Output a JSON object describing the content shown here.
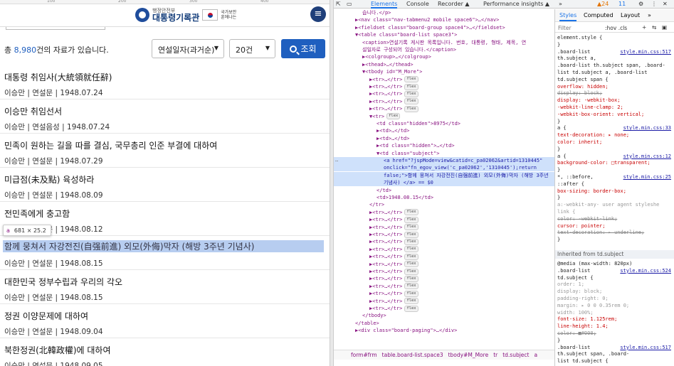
{
  "ruler": {
    "ticks": [
      "100",
      "200",
      "300",
      "400"
    ]
  },
  "site": {
    "logo_sub": "행정안전부",
    "logo_main": "대통령기록관",
    "logo_right": "국가보안 훈에나는",
    "menu_icon": "hamburger-icon"
  },
  "search": {
    "total_prefix": "총 ",
    "total_count": "8,980",
    "total_suffix": "건의 자료가 있습니다.",
    "order_value": "연설일자(과거순)",
    "count_value": "20건",
    "button_label": "조회"
  },
  "list": [
    {
      "title": "대통령 취임사(大統領就任辭)",
      "meta": "이승만 | 연설문 | 1948.07.24"
    },
    {
      "title": "이승만 취임선서",
      "meta": "이승만 | 연설음성 | 1948.07.24"
    },
    {
      "title": "민족이 원하는 길을 따를 결심, 국무총리 인준 부결에 대하여",
      "meta": "이승만 | 연설문 | 1948.07.29"
    },
    {
      "title": "미급점(未及點) 육성하라",
      "meta": "이승만 | 연설문 | 1948.08.09"
    },
    {
      "title": "전민족에게 충고함",
      "meta": "이승만 | 연설문 | 1948.08.12"
    },
    {
      "title": "함께 뭉쳐서 자강전진(自强前進) 외모(外侮)막자 (해방 3주년 기념사)",
      "meta": "이승만 | 연설문 | 1948.08.15"
    },
    {
      "title": "대한민국 정부수립과 우리의 각오",
      "meta": "이승만 | 연설문 | 1948.08.15"
    },
    {
      "title": "정권 이양문제에 대하여",
      "meta": "이승만 | 연설문 | 1948.09.04"
    },
    {
      "title": "북한정권(北韓政權)에 대하여",
      "meta": "이승만 | 연설문 | 1948.09.05"
    }
  ],
  "tooltip": {
    "tag": "a",
    "size": "681 × 25.2"
  },
  "devtools": {
    "tabs": [
      "Elements",
      "Console",
      "Recorder ▲",
      "Performance insights ▲",
      "»"
    ],
    "badges": [
      "▲24",
      "11"
    ],
    "dom_lines": [
      {
        "indent": 4,
        "html": "습니다.</p>"
      },
      {
        "indent": 2,
        "html": "▶<nav class=\"nav-tabmenu2 mobile space6\">…</nav>"
      },
      {
        "indent": 2,
        "html": "▶<fieldset class=\"board-group space4\">…</fieldset>"
      },
      {
        "indent": 2,
        "html": "▼<table class=\"board-list space3\">"
      },
      {
        "indent": 4,
        "html": "<caption>연설기록 게시판 목록입니다. 번호, 대통령, 형태, 제목, 연"
      },
      {
        "indent": 4,
        "html": "설일자로 구성되어 있습니다.</caption>"
      },
      {
        "indent": 4,
        "html": "▶<colgroup>…</colgroup>"
      },
      {
        "indent": 4,
        "html": "▶<thead>…</thead>"
      },
      {
        "indent": 4,
        "html": "▼<tbody id=\"M_More\">"
      },
      {
        "indent": 6,
        "html": "▶<tr>…</tr>",
        "flex": true
      },
      {
        "indent": 6,
        "html": "▶<tr>…</tr>",
        "flex": true
      },
      {
        "indent": 6,
        "html": "▶<tr>…</tr>",
        "flex": true
      },
      {
        "indent": 6,
        "html": "▶<tr>…</tr>",
        "flex": true
      },
      {
        "indent": 6,
        "html": "▶<tr>…</tr>",
        "flex": true
      },
      {
        "indent": 6,
        "html": "▼<tr>",
        "flex": true
      },
      {
        "indent": 8,
        "html": "<td class=\"hidden\">8975</td>"
      },
      {
        "indent": 8,
        "html": "▶<td>…</td>"
      },
      {
        "indent": 8,
        "html": "▶<td>…</td>"
      },
      {
        "indent": 8,
        "html": "▶<td class=\"hidden\">…</td>"
      },
      {
        "indent": 8,
        "html": "▼<td class=\"subject\">"
      },
      {
        "indent": 10,
        "html": "<a href=\"?jspMode=view&catid=c_pa02062&artid=1310445\"",
        "sel": true
      },
      {
        "indent": 10,
        "html": "onclick=\"fn_egov_view('c_pa02062','1310445');return",
        "sel": true
      },
      {
        "indent": 10,
        "html": "false;\">함께 뭉쳐서 자강전진(自强前進) 외모(外侮)막자 (해방 3주년",
        "sel": true
      },
      {
        "indent": 10,
        "html": "기념사) </a> == $0",
        "sel": true
      },
      {
        "indent": 8,
        "html": "</td>"
      },
      {
        "indent": 8,
        "html": "<td>1948.08.15</td>"
      },
      {
        "indent": 6,
        "html": "</tr>"
      },
      {
        "indent": 6,
        "html": "▶<tr>…</tr>",
        "flex": true
      },
      {
        "indent": 6,
        "html": "▶<tr>…</tr>",
        "flex": true
      },
      {
        "indent": 6,
        "html": "▶<tr>…</tr>",
        "flex": true
      },
      {
        "indent": 6,
        "html": "▶<tr>…</tr>",
        "flex": true
      },
      {
        "indent": 6,
        "html": "▶<tr>…</tr>",
        "flex": true
      },
      {
        "indent": 6,
        "html": "▶<tr>…</tr>",
        "flex": true
      },
      {
        "indent": 6,
        "html": "▶<tr>…</tr>",
        "flex": true
      },
      {
        "indent": 6,
        "html": "▶<tr>…</tr>",
        "flex": true
      },
      {
        "indent": 6,
        "html": "▶<tr>…</tr>",
        "flex": true
      },
      {
        "indent": 6,
        "html": "▶<tr>…</tr>",
        "flex": true
      },
      {
        "indent": 6,
        "html": "▶<tr>…</tr>",
        "flex": true
      },
      {
        "indent": 6,
        "html": "▶<tr>…</tr>",
        "flex": true
      },
      {
        "indent": 6,
        "html": "▶<tr>…</tr>",
        "flex": true
      },
      {
        "indent": 6,
        "html": "▶<tr>…</tr>",
        "flex": true
      },
      {
        "indent": 4,
        "html": "</tbody>"
      },
      {
        "indent": 2,
        "html": "</table>"
      },
      {
        "indent": 2,
        "html": "▶<div class=\"board-paging\">…</div>"
      }
    ],
    "breadcrumbs": [
      "form#frm",
      "table.board-list.space3",
      "tbody#M_More",
      "tr",
      "td.subject",
      "a"
    ],
    "styles_tabs": [
      "Styles",
      "Computed",
      "Layout",
      "»"
    ],
    "filter_placeholder": "Filter",
    "filter_buttons": ":hov .cls",
    "style_lines": [
      {
        "text": "element.style {",
        "cls": "sel-c"
      },
      {
        "text": "}",
        "cls": "sel-c"
      },
      {
        "text": ".board-list",
        "cls": "sel-c",
        "src": "style.min.css:517"
      },
      {
        "text": "th.subject a,",
        "cls": "sel-c"
      },
      {
        "text": ".board-list th.subject span, .board-",
        "cls": "sel-c"
      },
      {
        "text": "list td.subject a, .board-list",
        "cls": "sel-c"
      },
      {
        "text": "td.subject span {",
        "cls": "sel-c"
      },
      {
        "text": "  overflow: hidden;",
        "cls": "prop"
      },
      {
        "text": "  display: block;",
        "cls": "strike"
      },
      {
        "text": "  display: -webkit-box;",
        "cls": "prop"
      },
      {
        "text": "  -webkit-line-clamp: 2;",
        "cls": "prop"
      },
      {
        "text": "  -webkit-box-orient: vertical;",
        "cls": "prop"
      },
      {
        "text": "}",
        "cls": "sel-c"
      },
      {
        "text": "a {",
        "cls": "sel-c",
        "src": "style.min.css:33"
      },
      {
        "text": "  text-decoration: ▸ none;",
        "cls": "prop"
      },
      {
        "text": "  color: inherit;",
        "cls": "prop"
      },
      {
        "text": "}",
        "cls": "sel-c"
      },
      {
        "text": "a {",
        "cls": "sel-c",
        "src": "style.min.css:12"
      },
      {
        "text": "  background-color: □transparent;",
        "cls": "prop"
      },
      {
        "text": "}",
        "cls": "sel-c"
      },
      {
        "text": "*, ::before,",
        "cls": "sel-c",
        "src": "style.min.css:25"
      },
      {
        "text": "::after {",
        "cls": "sel-c"
      },
      {
        "text": "  box-sizing: border-box;",
        "cls": "prop"
      },
      {
        "text": "}",
        "cls": "sel-c"
      },
      {
        "text": "a:-webkit-any-  user agent styleshe",
        "cls": "muted"
      },
      {
        "text": "link {",
        "cls": "muted"
      },
      {
        "text": "  color: -webkit-link;",
        "cls": "strike"
      },
      {
        "text": "  cursor: pointer;",
        "cls": "prop"
      },
      {
        "text": "  text-decoration: ▸ underline;",
        "cls": "strike"
      },
      {
        "text": "}",
        "cls": "sel-c"
      }
    ],
    "inherited_label": "Inherited from td.subject",
    "style_lines2": [
      {
        "text": "@media (max-width: 820px)",
        "cls": "sel-c"
      },
      {
        "text": ".board-list",
        "cls": "sel-c",
        "src": "style.min.css:524"
      },
      {
        "text": "td.subject {",
        "cls": "sel-c"
      },
      {
        "text": "  order: 1;",
        "cls": "muted"
      },
      {
        "text": "  display: block;",
        "cls": "muted"
      },
      {
        "text": "  padding-right: 0;",
        "cls": "muted"
      },
      {
        "text": "  margin: ▸ 0 0 0.35rem 0;",
        "cls": "muted"
      },
      {
        "text": "  width: 100%;",
        "cls": "muted"
      },
      {
        "text": "  font-size: 1.125rem;",
        "cls": "prop"
      },
      {
        "text": "  line-height: 1.4;",
        "cls": "prop"
      },
      {
        "text": "  color: ■#000;",
        "cls": "strike"
      },
      {
        "text": "}",
        "cls": "sel-c"
      },
      {
        "text": ".board-list",
        "cls": "sel-c",
        "src": "style.min.css:517"
      },
      {
        "text": "th.subject span, .board-",
        "cls": "sel-c"
      },
      {
        "text": "list td.subject {",
        "cls": "sel-c"
      }
    ]
  },
  "colors": {
    "accent": "#1f5fbf",
    "highlight": "#b7cdf0",
    "devtools_selected": "#cfe1fb"
  }
}
